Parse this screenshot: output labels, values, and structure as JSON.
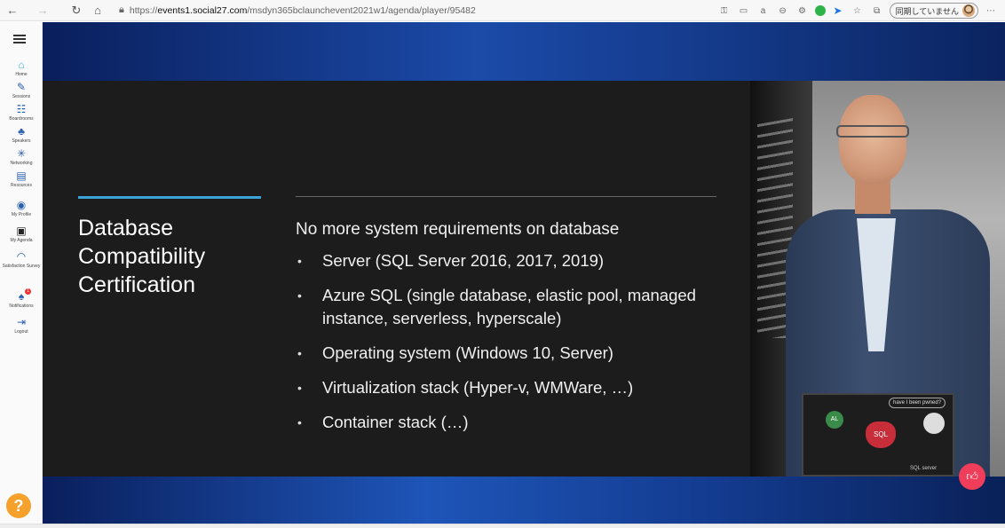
{
  "browser": {
    "url_prefix": "https://",
    "url_domain": "events1.social27.com",
    "url_path": "/msdyn365bclaunchevent2021w1/agenda/player/95482",
    "sync_label": "同期していません"
  },
  "sidebar": {
    "items": [
      {
        "label": "Home",
        "icon": "home-icon"
      },
      {
        "label": "Sessions",
        "icon": "pen-icon"
      },
      {
        "label": "Boardrooms",
        "icon": "boardroom-icon"
      },
      {
        "label": "Speakers",
        "icon": "speaker-icon"
      },
      {
        "label": "Networking",
        "icon": "networking-icon"
      },
      {
        "label": "Resources",
        "icon": "resources-icon"
      },
      {
        "label": "My Profile",
        "icon": "profile-icon"
      },
      {
        "label": "My Agenda",
        "icon": "calendar-icon"
      },
      {
        "label": "Satisfaction Survey",
        "icon": "survey-icon"
      },
      {
        "label": "Notifications",
        "icon": "bell-icon",
        "badge": "1"
      },
      {
        "label": "Logout",
        "icon": "logout-icon"
      }
    ],
    "help": "?"
  },
  "slide": {
    "title": "Database Compatibility Certification",
    "heading": "No more system requirements on database",
    "bullets": [
      "Server (SQL Server 2016, 2017, 2019)",
      "Azure SQL (single database, elastic pool, managed instance, serverless, hyperscale)",
      "Operating system (Windows 10, Server)",
      "Virtualization stack (Hyper-v, WMWare, …)",
      "Container stack (…)"
    ]
  },
  "video": {
    "sticker_pill": "have I been pwned?",
    "sticker_al": "AL",
    "sticker_sql": "SQL",
    "sticker_text": "SQL server"
  },
  "colors": {
    "slide_accent": "#3aa3d8",
    "like_button": "#ef3d5a",
    "help_button": "#f5a12b"
  }
}
